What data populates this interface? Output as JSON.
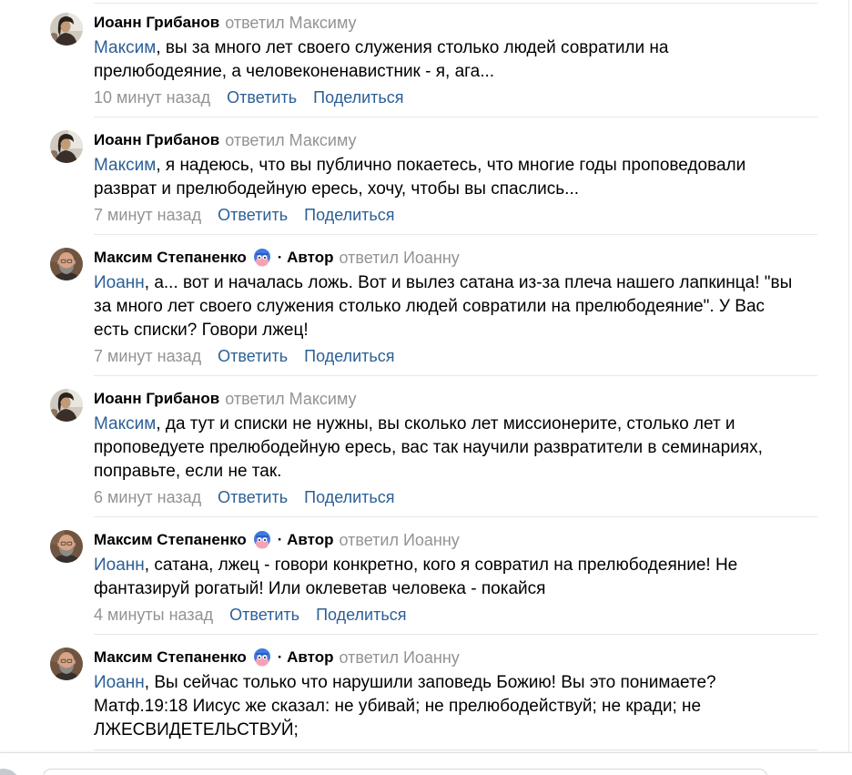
{
  "colors": {
    "link": "#2b5f96",
    "muted": "#939393",
    "text": "#000000",
    "divider": "#e7e8ec"
  },
  "actions": {
    "reply": "Ответить",
    "share": "Поделиться"
  },
  "author_label": "· Автор",
  "comments": [
    {
      "avatar": "ioann-avatar",
      "author": "Иоанн Грибанов",
      "reply_to": "ответил Максиму",
      "mention": "Максим",
      "lines": [
        ", вы за много лет своего служения столько людей совратили на",
        "прелюбодеяние, а человеконенавистник - я, ага..."
      ],
      "time": "10 минут назад"
    },
    {
      "avatar": "ioann-avatar",
      "author": "Иоанн Грибанов",
      "reply_to": "ответил Максиму",
      "mention": "Максим",
      "lines": [
        ", я надеюсь, что вы публично покаетесь, что многие годы проповедовали",
        "разврат и прелюбодейную ересь, хочу, чтобы вы спаслись..."
      ],
      "time": "7 минут назад"
    },
    {
      "avatar": "maxim-avatar",
      "author": "Максим Степаненко",
      "status_icon": "emoji-status-icon",
      "is_post_author": true,
      "reply_to": "ответил Иоанну",
      "mention": "Иоанн",
      "lines": [
        ", а... вот и началась ложь. Вот и вылез сатана из-за плеча нашего лапкинца! \"вы",
        "за много лет своего служения столько людей совратили на прелюбодеяние\". У Вас",
        "есть списки? Говори лжец!"
      ],
      "time": "7 минут назад"
    },
    {
      "avatar": "ioann-avatar",
      "author": "Иоанн Грибанов",
      "reply_to": "ответил Максиму",
      "mention": "Максим",
      "lines": [
        ", да тут и списки не нужны, вы сколько лет миссионерите, столько лет и",
        "проповедуете прелюбодейную ересь, вас так научили развратители в семинариях,",
        "поправьте, если не так."
      ],
      "time": "6 минут назад"
    },
    {
      "avatar": "maxim-avatar",
      "author": "Максим Степаненко",
      "status_icon": "emoji-status-icon",
      "is_post_author": true,
      "reply_to": "ответил Иоанну",
      "mention": "Иоанн",
      "lines": [
        ", сатана, лжец - говори конкретно, кого я совратил на прелюбодеяние! Не",
        "фантазируй рогатый! Или оклеветав человека - покайся"
      ],
      "time": "4 минуты назад"
    },
    {
      "avatar": "maxim-avatar",
      "author": "Максим Степаненко",
      "status_icon": "emoji-status-icon",
      "is_post_author": true,
      "reply_to": "ответил Иоанну",
      "mention": "Иоанн",
      "lines": [
        ", Вы сейчас только что нарушили заповедь Божию! Вы это понимаете?",
        "Матф.19:18 Иисус же сказал: не убивай; не прелюбодействуй; не кради; не",
        "ЛЖЕСВИДЕТЕЛЬСТВУЙ;"
      ]
    }
  ]
}
